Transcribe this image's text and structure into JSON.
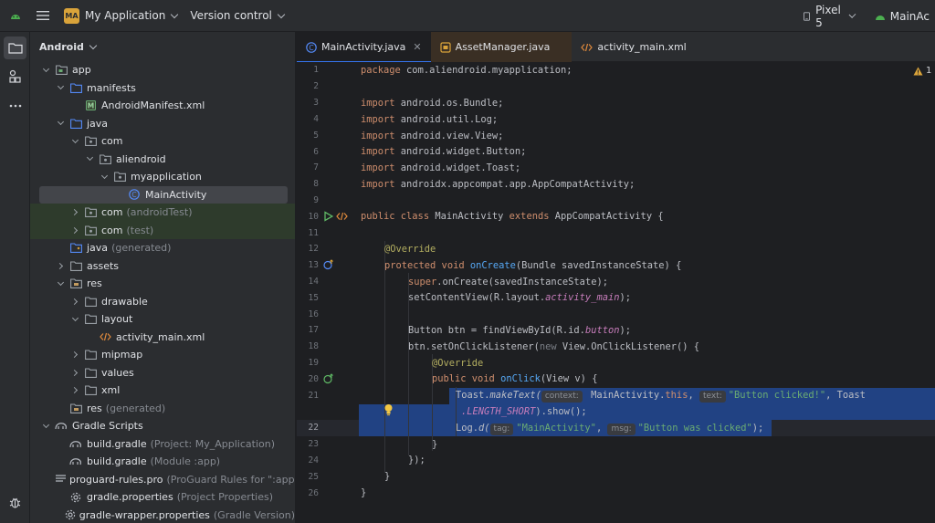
{
  "titlebar": {
    "project_badge": "MA",
    "project_name": "My Application",
    "vcs_label": "Version control",
    "device": "Pixel 5",
    "run_config": "MainAc"
  },
  "project_panel": {
    "view_mode": "Android",
    "tree": [
      {
        "label": "app",
        "suffix": ""
      },
      {
        "label": "manifests",
        "suffix": ""
      },
      {
        "label": "AndroidManifest.xml",
        "suffix": ""
      },
      {
        "label": "java",
        "suffix": ""
      },
      {
        "label": "com",
        "suffix": ""
      },
      {
        "label": "aliendroid",
        "suffix": ""
      },
      {
        "label": "myapplication",
        "suffix": ""
      },
      {
        "label": "MainActivity",
        "suffix": ""
      },
      {
        "label": "com",
        "suffix": "(androidTest)"
      },
      {
        "label": "com",
        "suffix": "(test)"
      },
      {
        "label": "java",
        "suffix": "(generated)"
      },
      {
        "label": "assets",
        "suffix": ""
      },
      {
        "label": "res",
        "suffix": ""
      },
      {
        "label": "drawable",
        "suffix": ""
      },
      {
        "label": "layout",
        "suffix": ""
      },
      {
        "label": "activity_main.xml",
        "suffix": ""
      },
      {
        "label": "mipmap",
        "suffix": ""
      },
      {
        "label": "values",
        "suffix": ""
      },
      {
        "label": "xml",
        "suffix": ""
      },
      {
        "label": "res",
        "suffix": "(generated)"
      },
      {
        "label": "Gradle Scripts",
        "suffix": ""
      },
      {
        "label": "build.gradle",
        "suffix": "(Project: My_Application)"
      },
      {
        "label": "build.gradle",
        "suffix": "(Module :app)"
      },
      {
        "label": "proguard-rules.pro",
        "suffix": "(ProGuard Rules for \":app\""
      },
      {
        "label": "gradle.properties",
        "suffix": "(Project Properties)"
      },
      {
        "label": "gradle-wrapper.properties",
        "suffix": "(Gradle Version)"
      }
    ]
  },
  "editor": {
    "tabs": [
      {
        "label": "MainActivity.java"
      },
      {
        "label": "AssetManager.java"
      },
      {
        "label": "activity_main.xml"
      }
    ],
    "warnings_count": "1",
    "line_numbers": [
      "1",
      "2",
      "3",
      "4",
      "5",
      "6",
      "7",
      "8",
      "9",
      "10",
      "11",
      "12",
      "13",
      "14",
      "15",
      "16",
      "17",
      "18",
      "19",
      "20",
      "21",
      "",
      "22",
      "23",
      "24",
      "25",
      "26"
    ],
    "code": {
      "l1_kw": "package",
      "l1_rest": " com.aliendroid.myapplication;",
      "l3_kw": "import",
      "l3_rest": " android.os.Bundle;",
      "l4_kw": "import",
      "l4_rest": " android.util.Log;",
      "l5_kw": "import",
      "l5_rest": " android.view.View;",
      "l6_kw": "import",
      "l6_rest": " android.widget.Button;",
      "l7_kw": "import",
      "l7_rest": " android.widget.Toast;",
      "l8_kw": "import",
      "l8_rest": " androidx.appcompat.app.AppCompatActivity;",
      "l10_kw1": "public class",
      "l10_name": " MainActivity ",
      "l10_kw2": "extends",
      "l10_rest": " AppCompatActivity {",
      "l12_an": "@Override",
      "l13_kw": "protected void",
      "l13_fn": "onCreate",
      "l13_rest": "(Bundle savedInstanceState) {",
      "l14_kw": "super",
      "l14_fn": ".onCreate",
      "l14_rest": "(savedInstanceState);",
      "l15_a": "setContentView(R.layout.",
      "l15_it": "activity_main",
      "l15_b": ");",
      "l17_a": "Button btn = findViewById(R.id.",
      "l17_it": "button",
      "l17_b": ");",
      "l18_a": "btn.setOnClickListener(",
      "l18_kw": "new",
      "l18_b": " View.OnClickListener() {",
      "l19_an": "@Override",
      "l20_kw": "public void",
      "l20_fn": "onClick",
      "l20_rest": "(View v) {",
      "l21_a": "Toast.",
      "l21_it": "makeText(",
      "l21_hint1": "context:",
      "l21_b": " MainActivity.",
      "l21_kw": "this",
      "l21_c": ", ",
      "l21_hint2": "text:",
      "l21_st": "\"Button clicked!\"",
      "l21_d": ", Toast",
      "l21w_it": ".LENGTH_SHORT",
      "l21w_rest": ").show();",
      "l22_a": "Log.",
      "l22_it": "d(",
      "l22_hint1": "tag:",
      "l22_st1": "\"MainActivity\"",
      "l22_c": ", ",
      "l22_hint2": "msg:",
      "l22_st2": "\"Button was clicked\"",
      "l22_d": ");",
      "l23": "}",
      "l24": "});",
      "l25": "}",
      "l26": "}"
    }
  },
  "colors": {
    "accent": "#3574f0",
    "selection": "#214283",
    "keyword": "#cf8e6d",
    "string": "#6aab73",
    "function": "#56a8f5"
  }
}
